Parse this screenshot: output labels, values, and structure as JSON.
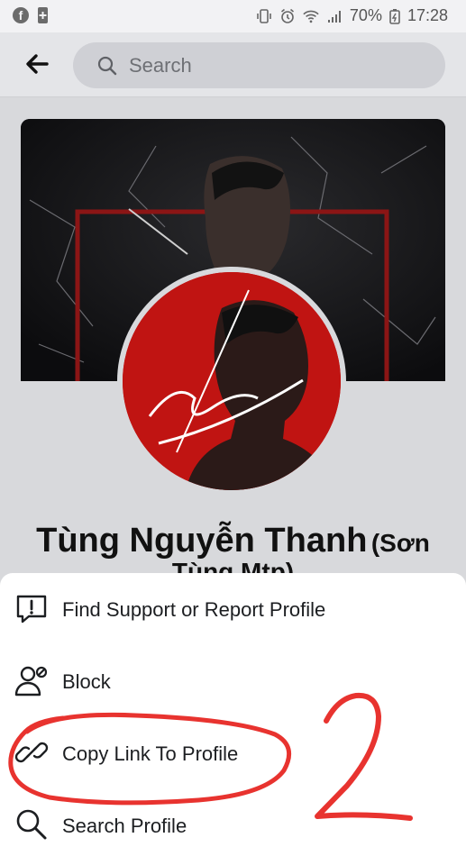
{
  "status_bar": {
    "battery_percent": "70%",
    "time": "17:28"
  },
  "search": {
    "placeholder": "Search"
  },
  "profile": {
    "name_main": "Tùng Nguyễn Thanh",
    "name_alt_part1": "(Sơn",
    "name_alt_part2": "Tùng Mtp)"
  },
  "menu": {
    "items": [
      {
        "label": "Find Support or Report Profile",
        "icon": "report-icon"
      },
      {
        "label": "Block",
        "icon": "block-user-icon"
      },
      {
        "label": "Copy Link To Profile",
        "icon": "link-icon"
      },
      {
        "label": "Search Profile",
        "icon": "search-icon"
      }
    ]
  },
  "annotation": {
    "handwritten_number": "2",
    "color": "#e8332f"
  }
}
